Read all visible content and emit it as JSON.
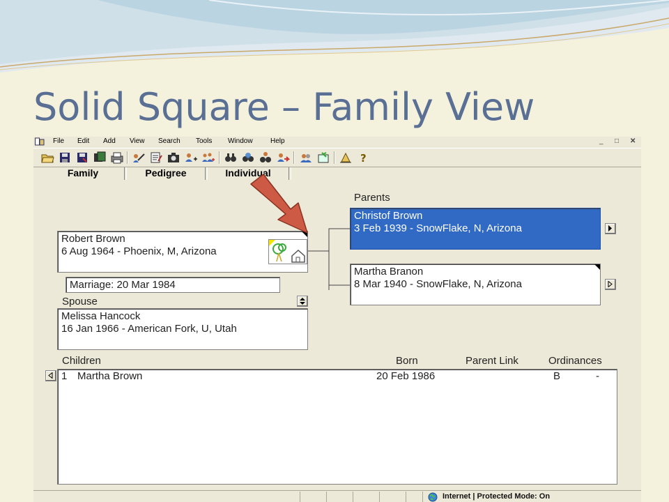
{
  "slide": {
    "title": "Solid Square – Family View"
  },
  "menubar": {
    "items": [
      "File",
      "Edit",
      "Add",
      "View",
      "Search",
      "Tools",
      "Window",
      "Help"
    ]
  },
  "tabs": [
    {
      "label": "Family"
    },
    {
      "label": "Pedigree"
    },
    {
      "label": "Individual"
    }
  ],
  "parents": {
    "heading": "Parents",
    "father": {
      "name": "Christof Brown",
      "details": "3 Feb 1939 - SnowFlake, N, Arizona"
    },
    "mother": {
      "name": "Martha Branon",
      "details": "8 Mar 1940 - SnowFlake, N, Arizona"
    }
  },
  "individual": {
    "name": "Robert Brown",
    "details": "6 Aug 1964 - Phoenix, M, Arizona",
    "marriage": "Marriage: 20 Mar 1984"
  },
  "spouse": {
    "heading": "Spouse",
    "name": "Melissa Hancock",
    "details": "16 Jan 1966 - American Fork, U, Utah"
  },
  "children": {
    "headers": [
      "Children",
      "Born",
      "Parent Link",
      "Ordinances"
    ],
    "rows": [
      {
        "num": "1",
        "name": "Martha Brown",
        "born": "20 Feb 1986",
        "parent_link": "",
        "ordinance_1": "B",
        "ordinance_2": "-"
      }
    ]
  },
  "statusbar": {
    "zone": "Internet | Protected Mode: On"
  },
  "colors": {
    "title": "#5a6f94",
    "selection": "#316ac5",
    "arrow": "#cc5a44",
    "window_bg": "#ece9d8"
  }
}
